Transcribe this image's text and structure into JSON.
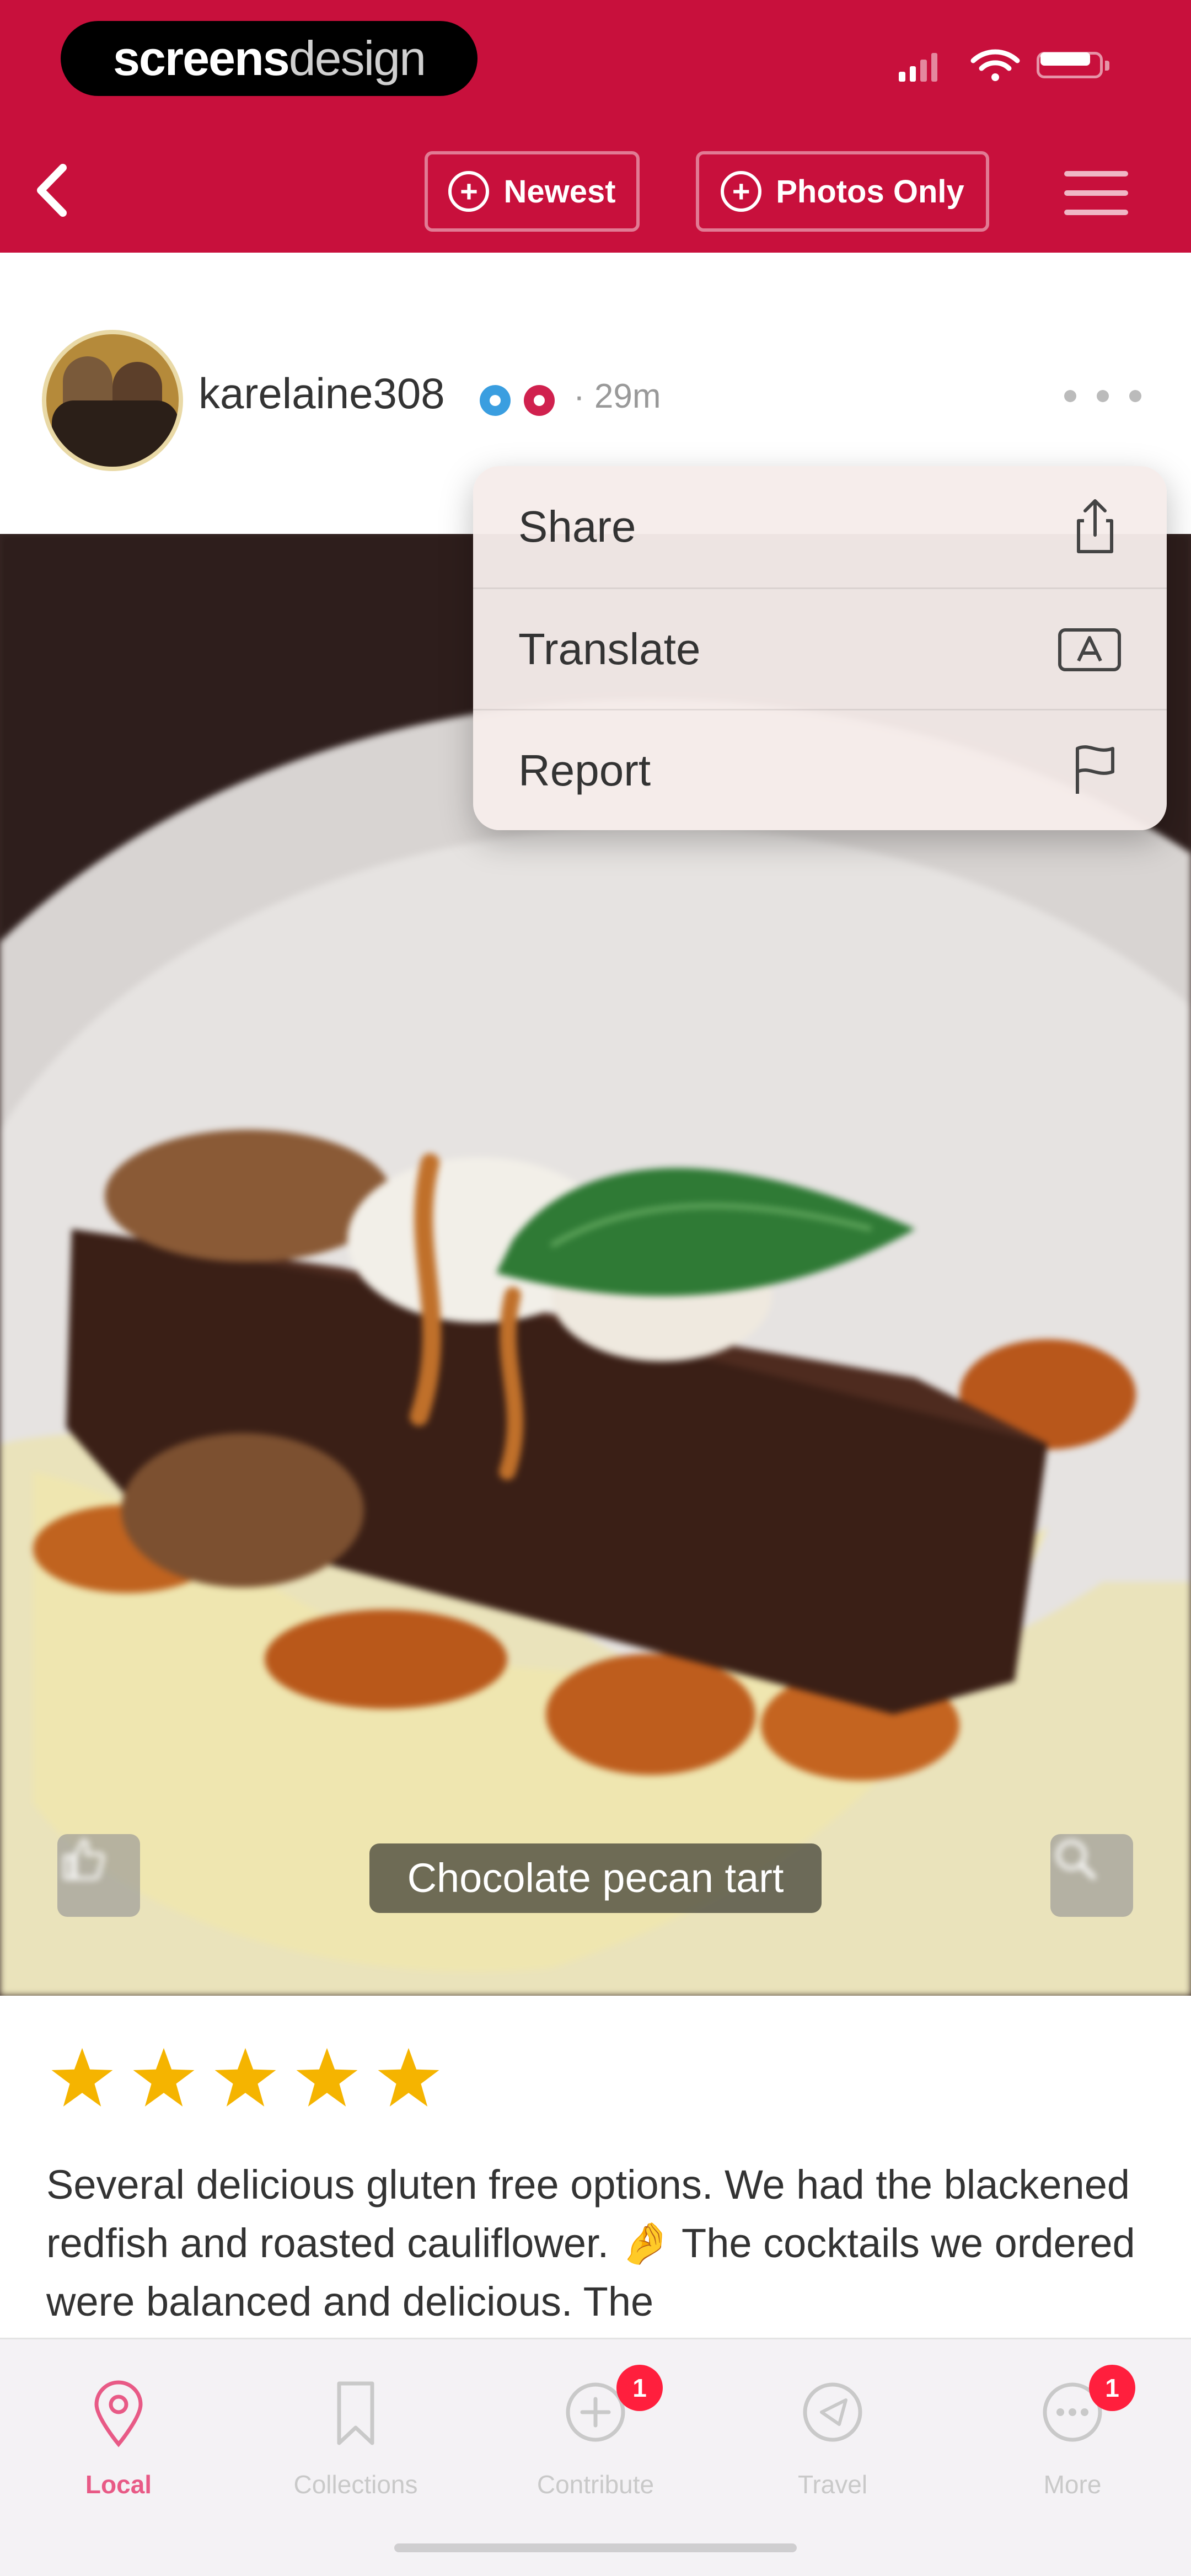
{
  "status_bar": {
    "logo_part1": "screens",
    "logo_part2": "design",
    "signal_icon": "signal-icon",
    "wifi_icon": "wifi-icon",
    "battery_icon": "battery-icon"
  },
  "toolbar": {
    "back_icon": "chevron-left-icon",
    "filters": [
      {
        "label": "Newest",
        "icon": "plus-circle-icon"
      },
      {
        "label": "Photos Only",
        "icon": "plus-circle-icon"
      }
    ],
    "menu_icon": "hamburger-icon"
  },
  "post": {
    "username": "karelaine308",
    "timestamp": "· 29m",
    "more_icon": "ellipsis-icon"
  },
  "context_menu": {
    "items": [
      {
        "label": "Share",
        "icon": "share-icon"
      },
      {
        "label": "Translate",
        "icon": "translate-icon"
      },
      {
        "label": "Report",
        "icon": "flag-icon"
      }
    ]
  },
  "photo": {
    "caption": "Chocolate pecan tart",
    "like_icon": "thumbs-up-icon",
    "zoom_icon": "magnifier-icon"
  },
  "review": {
    "rating": 5,
    "max_rating": 5,
    "star_color": "#f5b400",
    "text": "Several delicious gluten free options. We had the blackened redfish and roasted cauliflower. 🤌 The cocktails we ordered were balanced and delicious. The"
  },
  "tabbar": {
    "tabs": [
      {
        "label": "Local",
        "icon": "location-pin-icon",
        "active": true
      },
      {
        "label": "Collections",
        "icon": "bookmark-icon"
      },
      {
        "label": "Contribute",
        "icon": "plus-circle-icon",
        "badge": "1"
      },
      {
        "label": "Travel",
        "icon": "compass-icon"
      },
      {
        "label": "More",
        "icon": "ellipsis-circle-icon",
        "badge": "1"
      }
    ]
  },
  "colors": {
    "brand": "#c8103c",
    "active_tab": "#e85a86",
    "badge": "#ff1f3d"
  }
}
